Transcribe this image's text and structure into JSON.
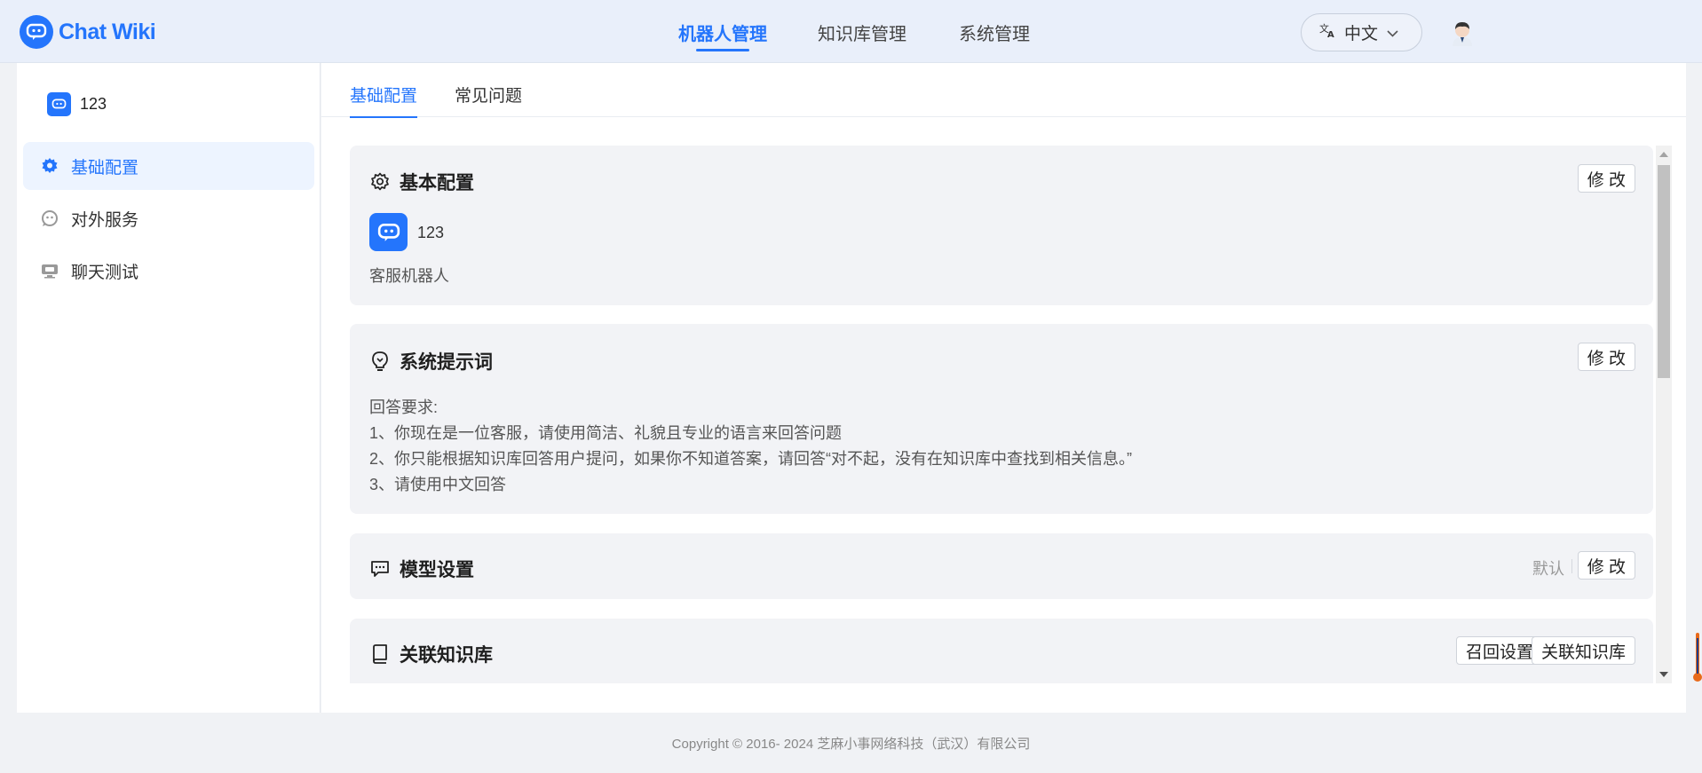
{
  "app": {
    "logo_text": "Chat Wiki"
  },
  "nav": {
    "items": [
      {
        "label": "机器人管理",
        "active": true
      },
      {
        "label": "知识库管理",
        "active": false
      },
      {
        "label": "系统管理",
        "active": false
      }
    ],
    "language": "中文"
  },
  "sidebar": {
    "robot_name": "123",
    "items": [
      {
        "label": "基础配置",
        "icon": "gear-icon",
        "active": true
      },
      {
        "label": "对外服务",
        "icon": "service-icon",
        "active": false
      },
      {
        "label": "聊天测试",
        "icon": "chat-test-icon",
        "active": false
      }
    ]
  },
  "tabs": [
    {
      "label": "基础配置",
      "active": true
    },
    {
      "label": "常见问题",
      "active": false
    }
  ],
  "cards": {
    "basic": {
      "title": "基本配置",
      "edit_label": "修 改",
      "robot_name": "123",
      "description": "客服机器人"
    },
    "prompt": {
      "title": "系统提示词",
      "edit_label": "修 改",
      "lines": [
        "回答要求:",
        "1、你现在是一位客服，请使用简洁、礼貌且专业的语言来回答问题",
        "2、你只能根据知识库回答用户提问，如果你不知道答案，请回答“对不起，没有在知识库中查找到相关信息。”",
        "3、请使用中文回答"
      ]
    },
    "model": {
      "title": "模型设置",
      "default_label": "默认",
      "edit_label": "修 改"
    },
    "knowledge": {
      "title": "关联知识库",
      "recall_label": "召回设置",
      "link_label": "关联知识库"
    }
  },
  "footer": {
    "copyright": "Copyright © 2016- 2024 芝麻小事网络科技（武汉）有限公司"
  },
  "colors": {
    "accent": "#2475fc",
    "header_bg": "#e9effa",
    "card_bg": "#f2f3f6"
  }
}
